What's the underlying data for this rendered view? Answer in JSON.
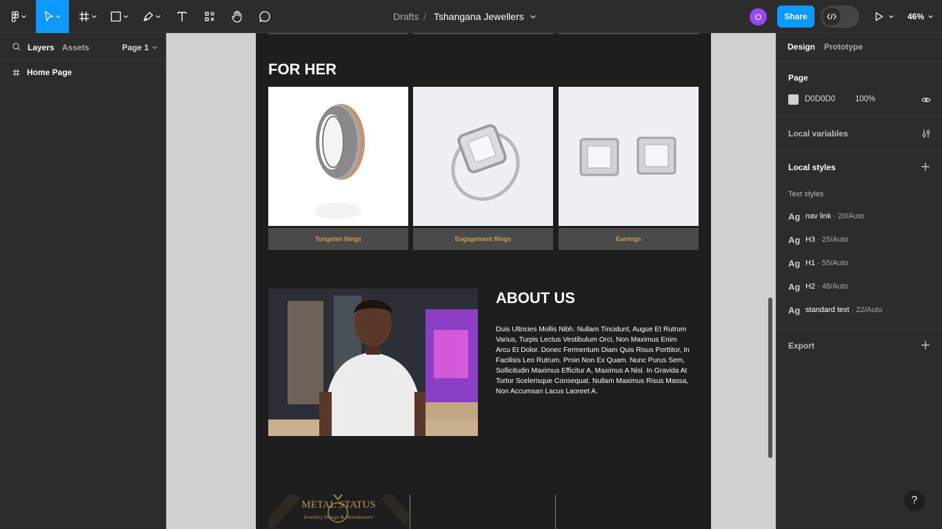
{
  "toolbar": {
    "tools": [
      "figma-menu",
      "move",
      "frame",
      "shape",
      "pen",
      "text",
      "resources",
      "hand",
      "comment"
    ]
  },
  "breadcrumb": {
    "folder": "Drafts",
    "separator": "/",
    "file_name": "Tshangana Jewellers"
  },
  "header_right": {
    "avatar_initial": "O",
    "avatar_color": "#9747ff",
    "share_label": "Share",
    "zoom_label": "46%"
  },
  "left_panel": {
    "tab_layers": "Layers",
    "tab_assets": "Assets",
    "page_selector": "Page 1",
    "layers": [
      {
        "label": "Home Page",
        "icon": "frame-icon"
      }
    ]
  },
  "design": {
    "for_her_title": "FOR HER",
    "products": [
      {
        "label": "Tungsten Rings",
        "image": "tungsten-ring"
      },
      {
        "label": "Engagement Rings",
        "image": "engagement-ring"
      },
      {
        "label": "Earrings",
        "image": "square-earrings"
      }
    ],
    "about_title": "ABOUT US",
    "about_text": "Duis Ultricies Mollis Nibh. Nullam Tincidunt, Augue Et Rutrum Varius, Turpis Lectus Vestibulum Orci, Non Maximus Enim Arcu Et Dolor. Donec Fermentum Diam Quis Risus Porttitor, In Facilisis Leo Rutrum. Proin Non Ex Quam. Nunc Purus Sem, Sollicitudin Maximus Efficitur A, Maximus A Nisl. In Gravida At Tortor Scelerisque Consequat. Nullam Maximus Risus Massa, Non Accumsan Lacus Laoreet A.",
    "footer_logo_line1": "METAL STATUS",
    "footer_logo_line2": "Jewellery Design & Manufacturer",
    "label_color": "#c9a24a"
  },
  "right_panel": {
    "tab_design": "Design",
    "tab_prototype": "Prototype",
    "page_heading": "Page",
    "page_color_hex": "D0D0D0",
    "page_opacity": "100%",
    "local_variables": "Local variables",
    "local_styles": "Local styles",
    "text_styles_heading": "Text styles",
    "text_styles": [
      {
        "ag": "Ag",
        "name": "nav link",
        "meta": " · 20/Auto"
      },
      {
        "ag": "Ag",
        "name": "H3",
        "meta": " · 25/Auto"
      },
      {
        "ag": "Ag",
        "name": "H1",
        "meta": " · 55/Auto"
      },
      {
        "ag": "Ag",
        "name": "H2",
        "meta": " · 48/Auto"
      },
      {
        "ag": "Ag",
        "name": "standard text",
        "meta": " · 22/Auto"
      }
    ],
    "export": "Export"
  },
  "help_label": "?"
}
